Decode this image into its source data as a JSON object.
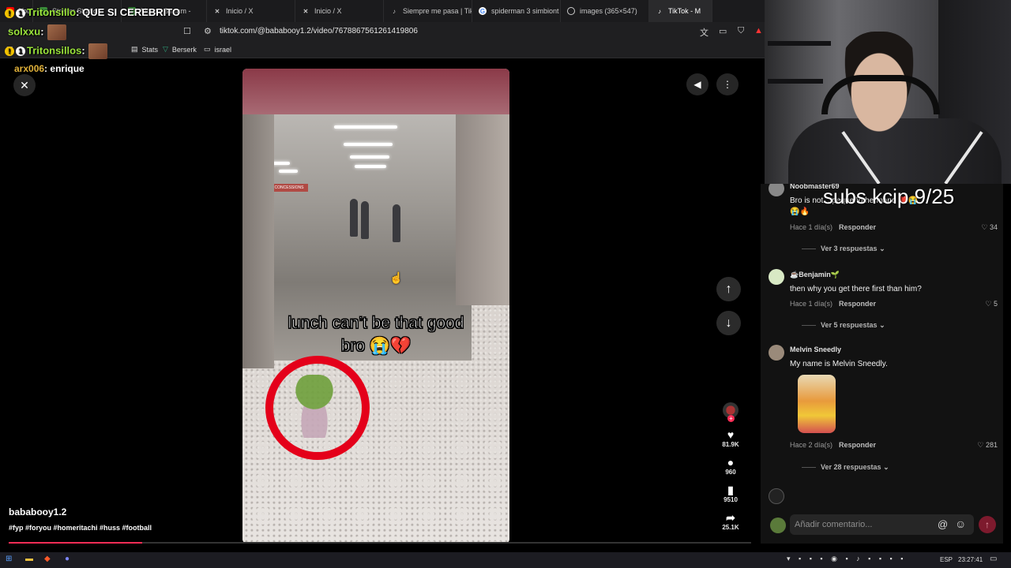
{
  "browser": {
    "tabs": [
      {
        "label": "YouTube",
        "icon": "youtube-icon"
      },
      {
        "label": "Stream Studio",
        "icon": "studio-icon"
      },
      {
        "label": "Moves Stream -",
        "icon": "stream-icon"
      },
      {
        "label": "Inicio / X",
        "icon": "x-icon"
      },
      {
        "label": "Inicio / X",
        "icon": "x-icon"
      },
      {
        "label": "Siempre me pasa | Tik",
        "icon": "tiktok-icon"
      },
      {
        "label": "spiderman 3 simbiont",
        "icon": "google-icon"
      },
      {
        "label": "images (365×547)",
        "icon": "globe-icon"
      },
      {
        "label": "TikTok - M",
        "icon": "tiktok-icon"
      }
    ],
    "url": "tiktok.com/@bababooy1.2/video/7678867561261419806",
    "bookmarks": [
      "Stats",
      "Berserk",
      "israel"
    ]
  },
  "overlay_chat": [
    {
      "user": "Tritonsillo",
      "message": "QUE SI CEREBRITO"
    },
    {
      "user": "solxxu",
      "message": ""
    },
    {
      "user": "Tritonsillos",
      "message": ""
    },
    {
      "user": "arx006",
      "message": "enrique"
    }
  ],
  "video": {
    "caption_line1": "lunch can’t be that good",
    "caption_line2": "bro 😭💔",
    "sign_text": "CONCESSIONS",
    "author": "bababooy1.2",
    "hashtags": "#fyp #foryou #homeritachi #huss #football",
    "progress": 0.18
  },
  "actions": {
    "likes": "81.9K",
    "comments": "960",
    "saves": "9510",
    "shares": "25.1K"
  },
  "comments": [
    {
      "name": "Noobmaster69",
      "text": "Bro is not... pequeño hermano ❤️😭",
      "text2": "😭🔥",
      "time": "Hace 1 día(s)",
      "reply": "Responder",
      "likes": "34",
      "replies": "Ver 3 respuestas"
    },
    {
      "name": "☕Benjamin🌱",
      "text": "then why you get there first than him?",
      "time": "Hace 1 día(s)",
      "reply": "Responder",
      "likes": "5",
      "replies": "Ver 5 respuestas"
    },
    {
      "name": "Melvin Sneedly",
      "text": "My name is Melvin Sneedly.",
      "time": "Hace 2 día(s)",
      "reply": "Responder",
      "likes": "281",
      "replies": "Ver 28 respuestas"
    }
  ],
  "stream_overlay_subs": "subs kcip 9/25",
  "comment_input_placeholder": "Añadir comentario...",
  "taskbar": {
    "language": "ESP",
    "clock": "23:27:41"
  },
  "colors": {
    "tiktok_red": "#fe2c55",
    "ring_red": "#e4001a",
    "chat_username": "#9ae33b"
  }
}
